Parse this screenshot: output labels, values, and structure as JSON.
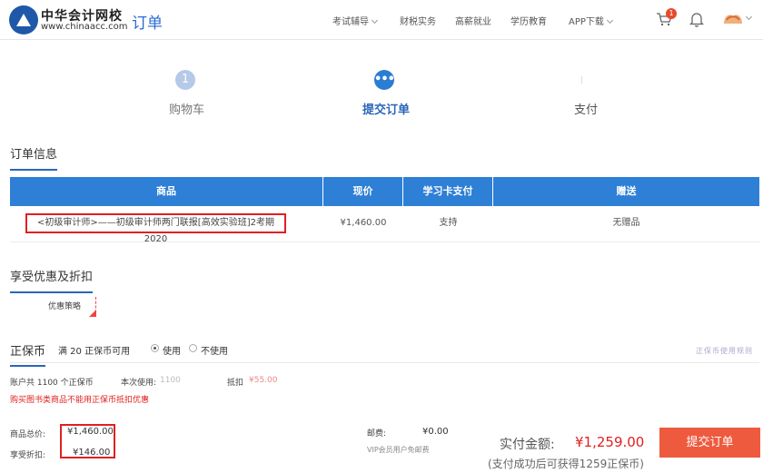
{
  "header": {
    "brand_name": "中华会计网校",
    "brand_url": "www.chinaacc.com",
    "page_title": "订单",
    "nav": [
      {
        "label": "考试辅导",
        "has_dropdown": true
      },
      {
        "label": "财税实务",
        "has_dropdown": false
      },
      {
        "label": "高薪就业",
        "has_dropdown": false
      },
      {
        "label": "学历教育",
        "has_dropdown": false
      },
      {
        "label": "APP下载",
        "has_dropdown": true
      }
    ],
    "cart_count": "1",
    "icons": [
      "logo-icon",
      "cart-icon",
      "bell-icon",
      "avatar"
    ]
  },
  "steps": [
    {
      "number": "1",
      "label": "购物车"
    },
    {
      "number": "•••",
      "label": "提交订单"
    },
    {
      "number": "",
      "label": "支付"
    }
  ],
  "order_info": {
    "title": "订单信息",
    "columns": [
      "商品",
      "现价",
      "学习卡支付",
      "赠送"
    ],
    "rows": [
      {
        "product": "<初级审计师>——初级审计师两门联报[高效实验班]2考期2020",
        "price": "¥1,460.00",
        "card_pay": "支持",
        "gift": "无赠品"
      }
    ]
  },
  "discount": {
    "title": "享受优惠及折扣",
    "coupon_label": "优惠策略"
  },
  "zhengbao": {
    "title": "正保币",
    "available": "满 20 正保币可用",
    "use_label": "使用",
    "not_use_label": "不使用",
    "selected": "使用",
    "rule_link": "正保币使用规则",
    "account_text": "账户共 1100 个正保币",
    "this_use_label": "本次使用:",
    "this_use_value": "1100",
    "deduct_label": "抵扣",
    "deduct_value": "¥55.00",
    "warning": "购买图书类商品不能用正保币抵扣优惠"
  },
  "totals": {
    "goods_total_label": "商品总价:",
    "goods_total_value": "¥1,460.00",
    "discount_label": "享受折扣:",
    "discount_value": "¥146.00",
    "shipping_label": "邮费:",
    "shipping_value": "¥0.00",
    "vip_note": "VIP会员用户免邮费",
    "pay_label": "实付金额:",
    "pay_value": "¥1,259.00",
    "pay_note": "(支付成功后可获得1259正保币)",
    "submit_label": "提交订单"
  },
  "colors": {
    "primary_blue": "#2e7fd6",
    "title_blue": "#2b6cd4",
    "accent_red": "#e02020",
    "submit_orange": "#ee5a3e"
  }
}
